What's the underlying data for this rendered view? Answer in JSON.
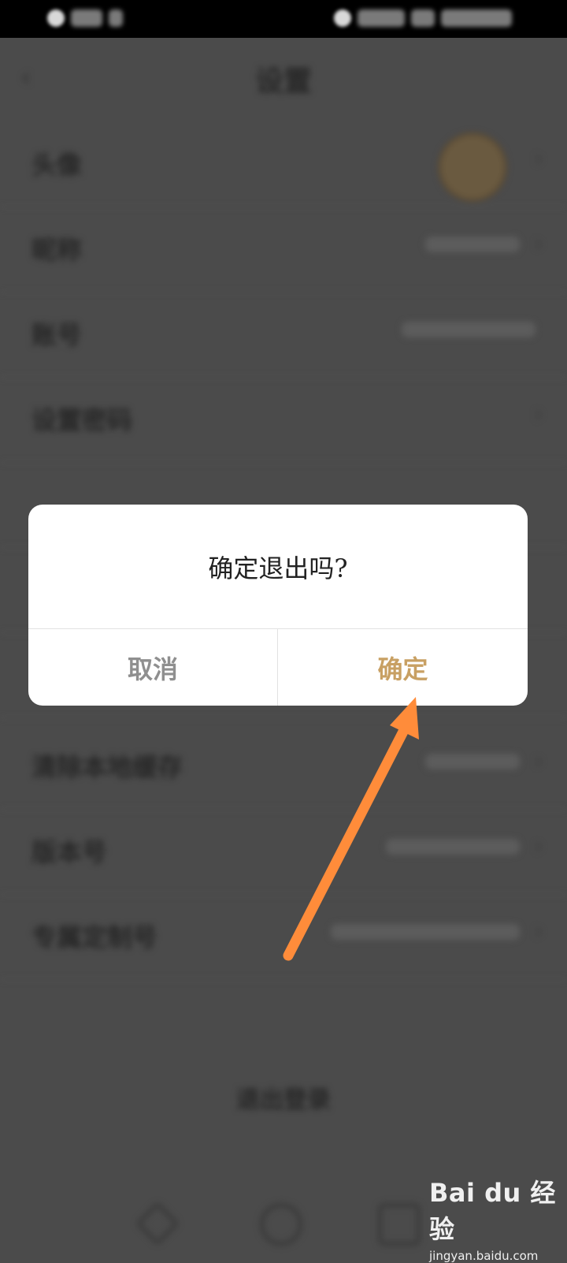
{
  "page": {
    "nav_title": "设置",
    "back_icon": "chevron-left-icon"
  },
  "settings_rows": [
    {
      "label": "头像"
    },
    {
      "label": "昵称"
    },
    {
      "label": "账号"
    },
    {
      "label": "设置密码"
    },
    {
      "label": "清除本地缓存"
    },
    {
      "label": "版本号"
    },
    {
      "label": "专属定制号"
    }
  ],
  "logout_label": "退出登录",
  "dialog": {
    "title": "确定退出吗?",
    "cancel_label": "取消",
    "confirm_label": "确定"
  },
  "colors": {
    "confirm": "#c8a063",
    "cancel": "#8f8f8f",
    "arrow": "#ff8c3a",
    "overlay": "#4b4b4b"
  },
  "watermark": {
    "logo_text": "Bai du 经验",
    "url": "jingyan.baidu.com"
  }
}
